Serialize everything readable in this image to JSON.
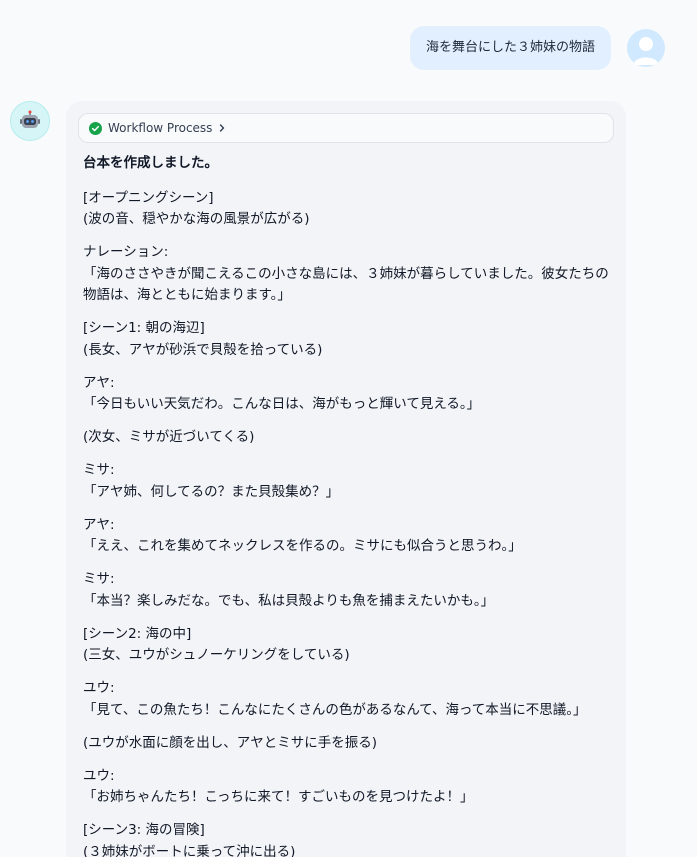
{
  "user_message": {
    "text": "海を舞台にした３姉妹の物語"
  },
  "bot_message": {
    "workflow_label": "Workflow Process",
    "heading": "台本を作成しました。",
    "paragraphs": [
      "[オープニングシーン]\n(波の音、穏やかな海の風景が広がる)",
      "ナレーション:\n「海のささやきが聞こえるこの小さな島には、３姉妹が暮らしていました。彼女たちの物語は、海とともに始まります。」",
      "[シーン1: 朝の海辺]\n(長女、アヤが砂浜で貝殻を拾っている)",
      "アヤ:\n「今日もいい天気だわ。こんな日は、海がもっと輝いて見える。」",
      "(次女、ミサが近づいてくる)",
      "ミサ:\n「アヤ姉、何してるの？また貝殻集め？」",
      "アヤ:\n「ええ、これを集めてネックレスを作るの。ミサにも似合うと思うわ。」",
      "ミサ:\n「本当？楽しみだな。でも、私は貝殻よりも魚を捕まえたいかも。」",
      "[シーン2: 海の中]\n(三女、ユウがシュノーケリングをしている)",
      "ユウ:\n「見て、この魚たち！こんなにたくさんの色があるなんて、海って本当に不思議。」",
      "(ユウが水面に顔を出し、アヤとミサに手を振る)",
      "ユウ:\n「お姉ちゃんたち！こっちに来て！すごいものを見つけたよ！」",
      "[シーン3: 海の冒険]\n(３姉妹がボートに乗って沖に出る)"
    ]
  },
  "colors": {
    "background": "#f9fafb",
    "user_bubble": "#e1effe",
    "bot_card": "#f2f4f7",
    "success_check": "#16a34a"
  }
}
